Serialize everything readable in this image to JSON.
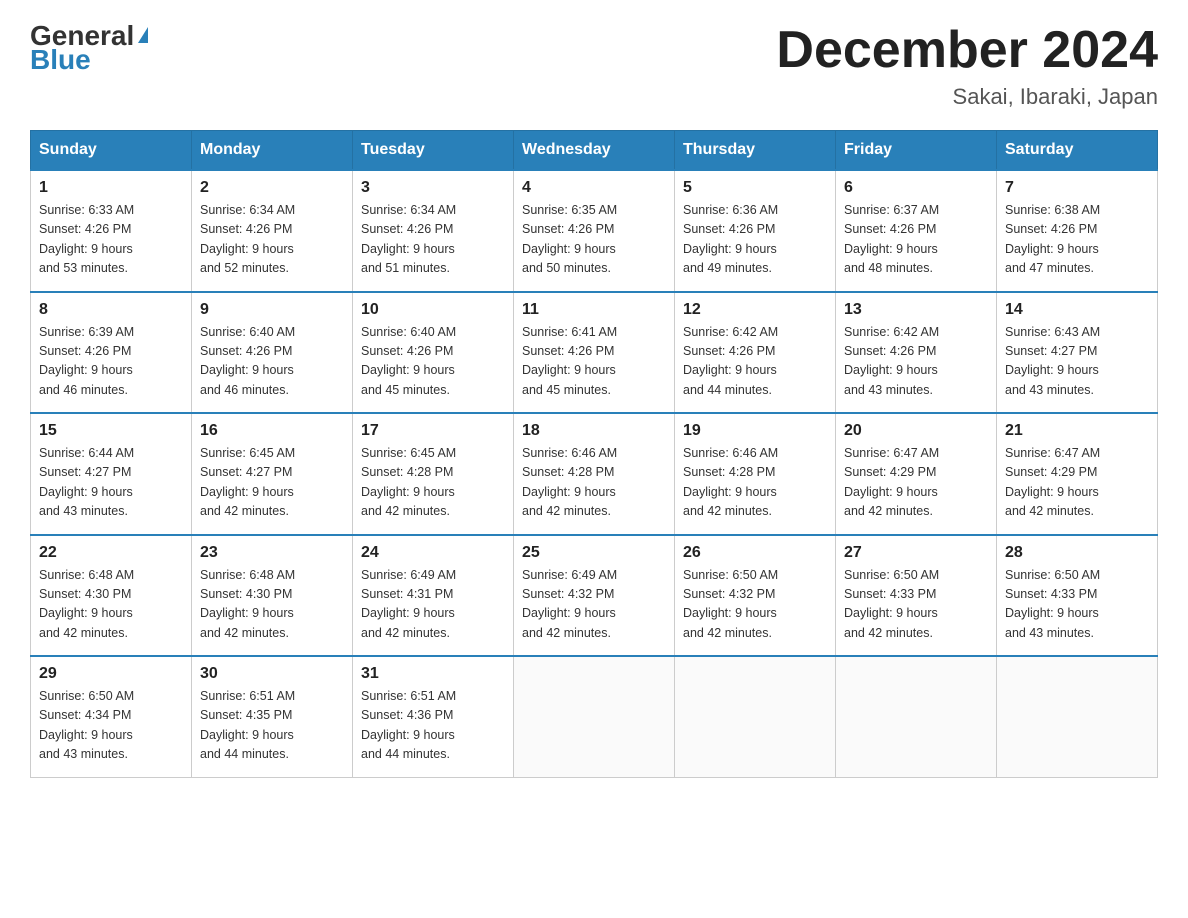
{
  "header": {
    "logo_general": "General",
    "logo_blue": "Blue",
    "month_title": "December 2024",
    "location": "Sakai, Ibaraki, Japan"
  },
  "days_of_week": [
    "Sunday",
    "Monday",
    "Tuesday",
    "Wednesday",
    "Thursday",
    "Friday",
    "Saturday"
  ],
  "weeks": [
    [
      {
        "day": "1",
        "sunrise": "6:33 AM",
        "sunset": "4:26 PM",
        "daylight": "9 hours and 53 minutes."
      },
      {
        "day": "2",
        "sunrise": "6:34 AM",
        "sunset": "4:26 PM",
        "daylight": "9 hours and 52 minutes."
      },
      {
        "day": "3",
        "sunrise": "6:34 AM",
        "sunset": "4:26 PM",
        "daylight": "9 hours and 51 minutes."
      },
      {
        "day": "4",
        "sunrise": "6:35 AM",
        "sunset": "4:26 PM",
        "daylight": "9 hours and 50 minutes."
      },
      {
        "day": "5",
        "sunrise": "6:36 AM",
        "sunset": "4:26 PM",
        "daylight": "9 hours and 49 minutes."
      },
      {
        "day": "6",
        "sunrise": "6:37 AM",
        "sunset": "4:26 PM",
        "daylight": "9 hours and 48 minutes."
      },
      {
        "day": "7",
        "sunrise": "6:38 AM",
        "sunset": "4:26 PM",
        "daylight": "9 hours and 47 minutes."
      }
    ],
    [
      {
        "day": "8",
        "sunrise": "6:39 AM",
        "sunset": "4:26 PM",
        "daylight": "9 hours and 46 minutes."
      },
      {
        "day": "9",
        "sunrise": "6:40 AM",
        "sunset": "4:26 PM",
        "daylight": "9 hours and 46 minutes."
      },
      {
        "day": "10",
        "sunrise": "6:40 AM",
        "sunset": "4:26 PM",
        "daylight": "9 hours and 45 minutes."
      },
      {
        "day": "11",
        "sunrise": "6:41 AM",
        "sunset": "4:26 PM",
        "daylight": "9 hours and 45 minutes."
      },
      {
        "day": "12",
        "sunrise": "6:42 AM",
        "sunset": "4:26 PM",
        "daylight": "9 hours and 44 minutes."
      },
      {
        "day": "13",
        "sunrise": "6:42 AM",
        "sunset": "4:26 PM",
        "daylight": "9 hours and 43 minutes."
      },
      {
        "day": "14",
        "sunrise": "6:43 AM",
        "sunset": "4:27 PM",
        "daylight": "9 hours and 43 minutes."
      }
    ],
    [
      {
        "day": "15",
        "sunrise": "6:44 AM",
        "sunset": "4:27 PM",
        "daylight": "9 hours and 43 minutes."
      },
      {
        "day": "16",
        "sunrise": "6:45 AM",
        "sunset": "4:27 PM",
        "daylight": "9 hours and 42 minutes."
      },
      {
        "day": "17",
        "sunrise": "6:45 AM",
        "sunset": "4:28 PM",
        "daylight": "9 hours and 42 minutes."
      },
      {
        "day": "18",
        "sunrise": "6:46 AM",
        "sunset": "4:28 PM",
        "daylight": "9 hours and 42 minutes."
      },
      {
        "day": "19",
        "sunrise": "6:46 AM",
        "sunset": "4:28 PM",
        "daylight": "9 hours and 42 minutes."
      },
      {
        "day": "20",
        "sunrise": "6:47 AM",
        "sunset": "4:29 PM",
        "daylight": "9 hours and 42 minutes."
      },
      {
        "day": "21",
        "sunrise": "6:47 AM",
        "sunset": "4:29 PM",
        "daylight": "9 hours and 42 minutes."
      }
    ],
    [
      {
        "day": "22",
        "sunrise": "6:48 AM",
        "sunset": "4:30 PM",
        "daylight": "9 hours and 42 minutes."
      },
      {
        "day": "23",
        "sunrise": "6:48 AM",
        "sunset": "4:30 PM",
        "daylight": "9 hours and 42 minutes."
      },
      {
        "day": "24",
        "sunrise": "6:49 AM",
        "sunset": "4:31 PM",
        "daylight": "9 hours and 42 minutes."
      },
      {
        "day": "25",
        "sunrise": "6:49 AM",
        "sunset": "4:32 PM",
        "daylight": "9 hours and 42 minutes."
      },
      {
        "day": "26",
        "sunrise": "6:50 AM",
        "sunset": "4:32 PM",
        "daylight": "9 hours and 42 minutes."
      },
      {
        "day": "27",
        "sunrise": "6:50 AM",
        "sunset": "4:33 PM",
        "daylight": "9 hours and 42 minutes."
      },
      {
        "day": "28",
        "sunrise": "6:50 AM",
        "sunset": "4:33 PM",
        "daylight": "9 hours and 43 minutes."
      }
    ],
    [
      {
        "day": "29",
        "sunrise": "6:50 AM",
        "sunset": "4:34 PM",
        "daylight": "9 hours and 43 minutes."
      },
      {
        "day": "30",
        "sunrise": "6:51 AM",
        "sunset": "4:35 PM",
        "daylight": "9 hours and 44 minutes."
      },
      {
        "day": "31",
        "sunrise": "6:51 AM",
        "sunset": "4:36 PM",
        "daylight": "9 hours and 44 minutes."
      },
      null,
      null,
      null,
      null
    ]
  ],
  "labels": {
    "sunrise": "Sunrise:",
    "sunset": "Sunset:",
    "daylight": "Daylight:"
  }
}
